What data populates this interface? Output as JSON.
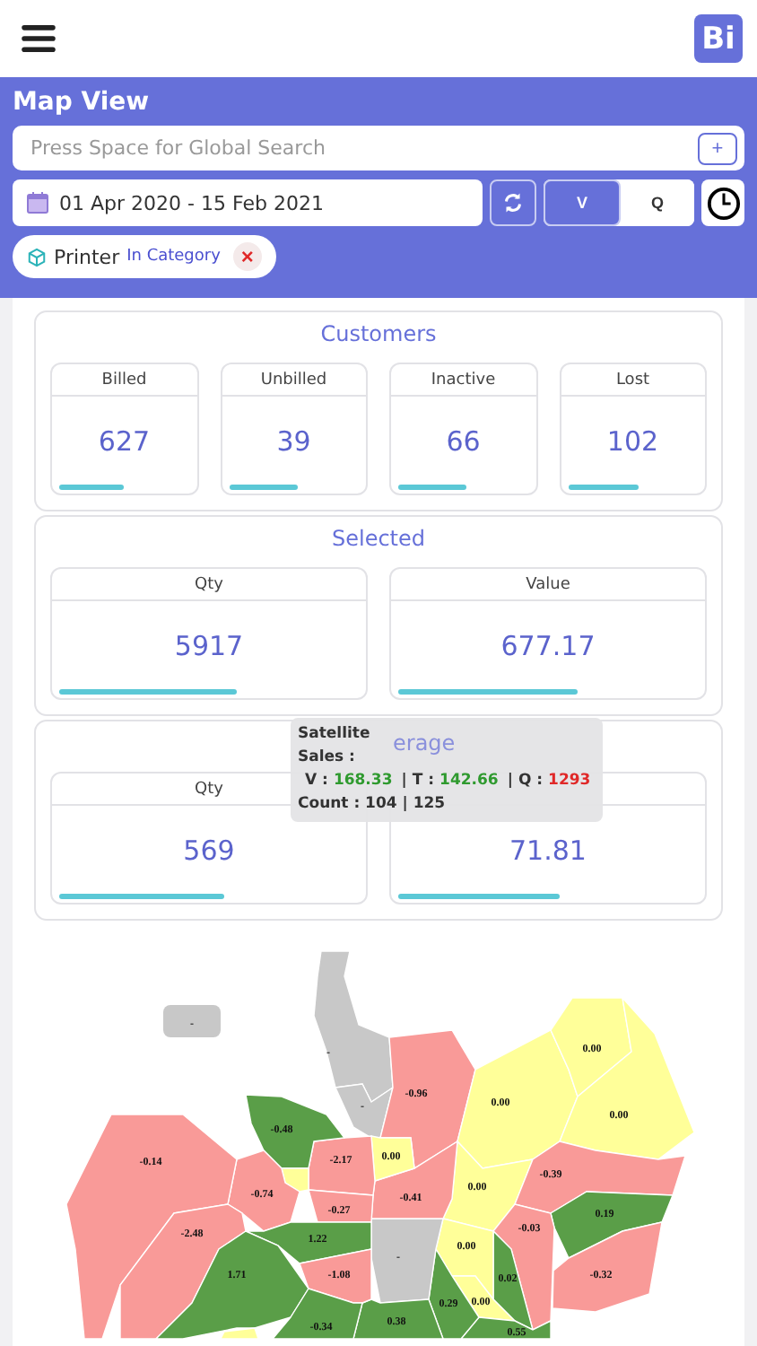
{
  "app_bar": {
    "logo": "Bi"
  },
  "panel": {
    "title": "Map View",
    "search": {
      "placeholder": "Press Space for Global Search",
      "add": "+"
    },
    "date_range": "01 Apr 2020 - 15 Feb 2021",
    "toggle": [
      {
        "label": "V",
        "selected": true
      },
      {
        "label": "Q",
        "selected": false
      }
    ],
    "filter_chip": {
      "name": "Printer",
      "scope": "In Category",
      "remove": "×"
    }
  },
  "sections": [
    {
      "title": "Customers",
      "metrics": [
        {
          "label": "Billed",
          "value": "627",
          "level": 0.5
        },
        {
          "label": "Unbilled",
          "value": "39",
          "level": 0.53
        },
        {
          "label": "Inactive",
          "value": "66",
          "level": 0.52
        },
        {
          "label": "Lost",
          "value": "102",
          "level": 0.55
        }
      ]
    },
    {
      "title": "Selected",
      "metrics": [
        {
          "label": "Qty",
          "value": "5917",
          "level": 0.59
        },
        {
          "label": "Value",
          "value": "677.17",
          "level": 0.6
        }
      ]
    },
    {
      "title": "erage",
      "metrics": [
        {
          "label": "Qty",
          "value": "569",
          "level": 0.55
        },
        {
          "value": "71.81",
          "level": 0.54
        }
      ]
    }
  ],
  "tooltip": {
    "title": "Satellite",
    "sales_label": "Sales :",
    "separator": "|",
    "values": [
      {
        "label": "V :",
        "value": "168.33",
        "color": "#2f9a2f"
      },
      {
        "label": "T :",
        "value": "142.66",
        "color": "#2f9a2f"
      },
      {
        "label": "Q :",
        "value": "1293",
        "color": "#e02828"
      }
    ],
    "count": "Count : 104 | 125"
  },
  "map": {
    "regions": [
      {
        "label": "-",
        "color": "#c8c8c8"
      },
      {
        "label": "-",
        "color": "#c8c8c8"
      },
      {
        "label": "-",
        "color": "#c8c8c8"
      },
      {
        "label": "-0.96",
        "color": "#f99a98"
      },
      {
        "label": "0.00",
        "color": "#ffff99"
      },
      {
        "label": "0.00",
        "color": "#ffff99"
      },
      {
        "label": "0.00",
        "color": "#ffff99"
      },
      {
        "label": "0.00",
        "color": "#ffff99"
      },
      {
        "label": "-0.39",
        "color": "#f99a98"
      },
      {
        "label": "0.19",
        "color": "#5a9e48"
      },
      {
        "label": "-0.32",
        "color": "#f99a98"
      },
      {
        "label": "-0.03",
        "color": "#f99a98"
      },
      {
        "label": "0.02",
        "color": "#5a9e48"
      },
      {
        "label": "0.00",
        "color": "#ffff99"
      },
      {
        "label": "0.00",
        "color": "#ffff99"
      },
      {
        "label": "0.55",
        "color": "#5a9e48"
      },
      {
        "label": "0.29",
        "color": "#5a9e48"
      },
      {
        "label": "-",
        "color": "#c8c8c8"
      },
      {
        "label": "0.38",
        "color": "#5a9e48"
      },
      {
        "label": "-0.41",
        "color": "#f99a98"
      },
      {
        "label": "0.00",
        "color": "#ffff99"
      },
      {
        "label": "-2.17",
        "color": "#f99a98"
      },
      {
        "label": "-0.27",
        "color": "#f99a98"
      },
      {
        "label": "-0.48",
        "color": "#5a9e48"
      },
      {
        "color": "#ffff99"
      },
      {
        "label": "-0.74",
        "color": "#f99a98"
      },
      {
        "label": "-0.14",
        "color": "#f99a98"
      },
      {
        "label": "-2.48",
        "color": "#f99a98"
      },
      {
        "label": "1.22",
        "color": "#5a9e48"
      },
      {
        "label": "1.71",
        "color": "#5a9e48"
      },
      {
        "label": "-1.08",
        "color": "#f99a98"
      },
      {
        "label": "-0.34",
        "color": "#5a9e48"
      },
      {
        "color": "#ffff99"
      }
    ]
  }
}
